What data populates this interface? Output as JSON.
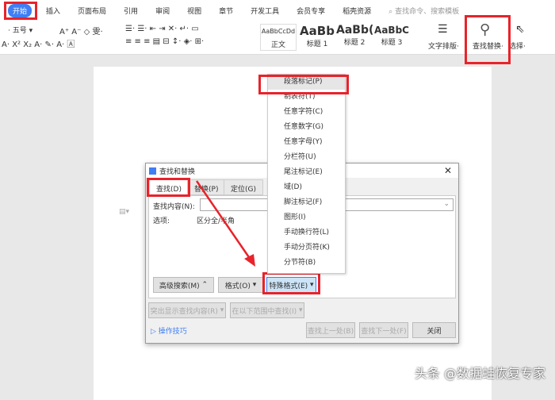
{
  "tabs": [
    "开始",
    "插入",
    "页面布局",
    "引用",
    "审阅",
    "视图",
    "章节",
    "开发工具",
    "会员专享",
    "稻壳资源"
  ],
  "search_placeholder": "查找命令、搜索模板",
  "ribbon": {
    "font_size": "五号",
    "styles": [
      {
        "preview": "AaBbCcDd",
        "label": "正文"
      },
      {
        "preview": "AaBb",
        "label": "标题 1"
      },
      {
        "preview": "AaBb(",
        "label": "标题 2"
      },
      {
        "preview": "AaBbC",
        "label": "标题 3"
      }
    ],
    "text_layout": "文字排版",
    "find_replace": "查找替换",
    "select": "选择"
  },
  "dialog": {
    "title": "查找和替换",
    "tabs": [
      "查找(D)",
      "替换(P)",
      "定位(G)"
    ],
    "find_label": "查找内容(N):",
    "find_value": "",
    "options_label": "选项:",
    "options_value": "区分全/半角",
    "advanced": "高级搜索(M)",
    "format": "格式(O)",
    "special": "特殊格式(E)",
    "highlight": "突出显示查找内容(R)",
    "find_in": "在以下范围中查找(I)",
    "tips": "操作技巧",
    "prev": "查找上一处(B)",
    "next": "查找下一处(F)",
    "close": "关闭"
  },
  "menu": [
    "段落标记(P)",
    "制表符(T)",
    "任意字符(C)",
    "任意数字(G)",
    "任意字母(Y)",
    "分栏符(U)",
    "尾注标记(E)",
    "域(D)",
    "脚注标记(F)",
    "图形(I)",
    "手动换行符(L)",
    "手动分页符(K)",
    "分节符(B)"
  ],
  "watermark": "头条 @数据蛙恢复专家",
  "accent": "#3f7ef5",
  "highlight_red": "#e8232b"
}
